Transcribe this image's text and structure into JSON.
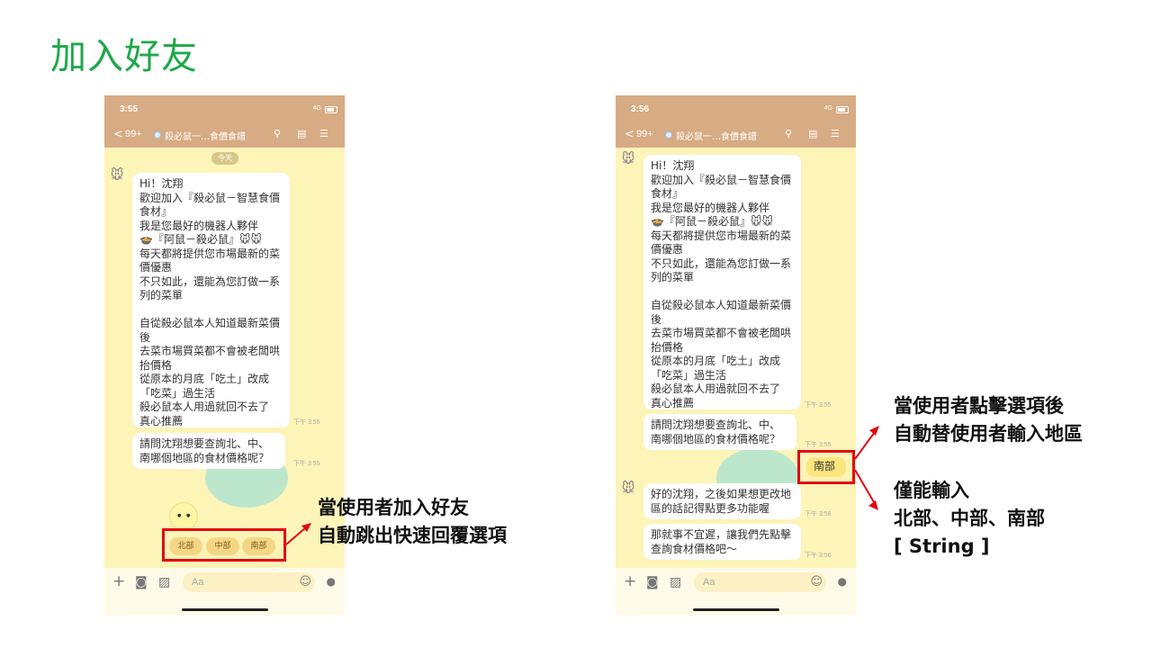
{
  "slide_title": "加入好友",
  "phone_left": {
    "time": "3:55",
    "network": "4G",
    "back_count": "99+",
    "chat_name": "殺必鼠一…食價食譜",
    "date_pill": "今天",
    "welcome_message": "Hi！沈翔\n歡迎加入『殺必鼠－智慧食價食材』\n我是您最好的機器人夥伴\n🍲『阿鼠－殺必鼠』🐭🐭\n每天都將提供您市場最新的菜價優惠\n不只如此，還能為您訂做一系列的菜單\n\n自從殺必鼠本人知道最新菜價後\n去菜市場買菜都不會被老闆哄抬價格\n從原本的月底「吃土」改成「吃菜」過生活\n殺必鼠本人用過就回不去了\n真心推薦",
    "welcome_time": "下午 3:55",
    "question_message": "請問沈翔想要查詢北、中、南哪個地區的食材價格呢？",
    "question_time": "下午 3:55",
    "quick_replies": [
      "北部",
      "中部",
      "南部"
    ],
    "input_placeholder": "Aa"
  },
  "phone_right": {
    "time": "3:56",
    "network": "4G",
    "back_count": "99+",
    "chat_name": "殺必鼠一…食價食譜",
    "welcome_message": "Hi！沈翔\n歡迎加入『殺必鼠－智慧食價食材』\n我是您最好的機器人夥伴\n🍲『阿鼠－殺必鼠』🐭🐭\n每天都將提供您市場最新的菜價優惠\n不只如此，還能為您訂做一系列的菜單\n\n自從殺必鼠本人知道最新菜價後\n去菜市場買菜都不會被老闆哄抬價格\n從原本的月底「吃土」改成「吃菜」過生活\n殺必鼠本人用過就回不去了\n真心推薦",
    "welcome_time": "下午 3:55",
    "question_message": "請問沈翔想要查詢北、中、南哪個地區的食材價格呢？",
    "question_time": "下午 3:55",
    "user_reply": "南部",
    "reply_1": "好的沈翔，之後如果想更改地區的話記得點更多功能喔",
    "reply_1_time": "下午 3:56",
    "reply_2": "那就事不宜遲，讓我們先點擊查詢食材價格吧～",
    "reply_2_time": "下午 3:56",
    "input_placeholder": "Aa"
  },
  "annotations": {
    "quick_reply_note": "當使用者加入好友\n自動跳出快速回覆選項",
    "auto_input_note": "當使用者點擊選項後\n自動替使用者輸入地區",
    "allowed_input_note": "僅能輸入\n北部、中部、南部\n[ String ]"
  },
  "colors": {
    "title_green": "#1ea84a",
    "header_tan": "#d7ab83",
    "chat_background": "#fdf4b8",
    "highlight_red": "#e30613",
    "quick_reply_fill": "#f5d684"
  },
  "icons": [
    "back-chevron-icon",
    "search-icon",
    "note-icon",
    "menu-icon",
    "plus-icon",
    "camera-icon",
    "image-icon",
    "emoji-icon",
    "mic-icon",
    "mouse-avatar-icon"
  ]
}
